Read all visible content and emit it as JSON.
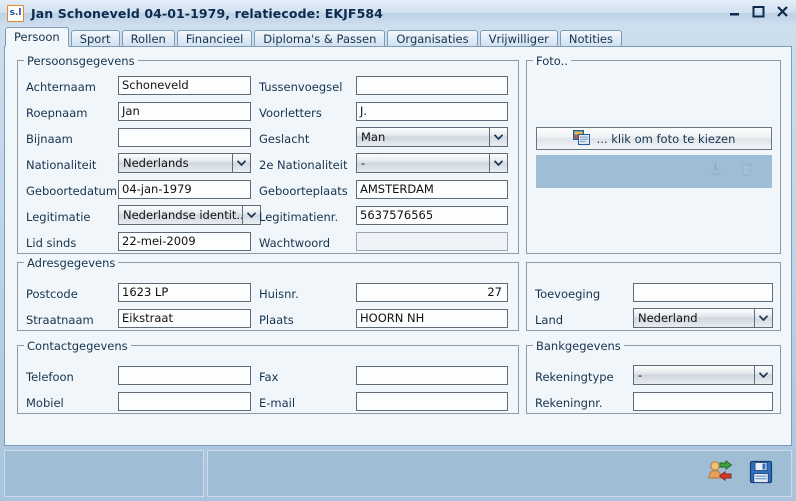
{
  "window": {
    "app_icon_text": "s.l",
    "title": "Jan Schoneveld  04-01-1979, relatiecode: EKJF584",
    "minimize_label": "Minimize",
    "maximize_label": "Maximize",
    "close_label": "Close"
  },
  "tabs": [
    {
      "label": "Persoon",
      "active": true
    },
    {
      "label": "Sport",
      "active": false
    },
    {
      "label": "Rollen",
      "active": false
    },
    {
      "label": "Financieel",
      "active": false
    },
    {
      "label": "Diploma's & Passen",
      "active": false
    },
    {
      "label": "Organisaties",
      "active": false
    },
    {
      "label": "Vrijwilliger",
      "active": false
    },
    {
      "label": "Notities",
      "active": false
    }
  ],
  "groups": {
    "persoonsgegevens": {
      "title": "Persoonsgegevens",
      "fields": {
        "achternaam": {
          "label": "Achternaam",
          "value": "Schoneveld"
        },
        "roepnaam": {
          "label": "Roepnaam",
          "value": "Jan"
        },
        "bijnaam": {
          "label": "Bijnaam",
          "value": ""
        },
        "nationaliteit": {
          "label": "Nationaliteit",
          "value": "Nederlands"
        },
        "geboortedatum": {
          "label": "Geboortedatum",
          "value": "04-jan-1979"
        },
        "legitimatie": {
          "label": "Legitimatie",
          "value": "Nederlandse identit..."
        },
        "lid_sinds": {
          "label": "Lid sinds",
          "value": "22-mei-2009"
        },
        "tussenvoegsel": {
          "label": "Tussenvoegsel",
          "value": ""
        },
        "voorletters": {
          "label": "Voorletters",
          "value": "J."
        },
        "geslacht": {
          "label": "Geslacht",
          "value": "Man"
        },
        "tweede_nationaliteit": {
          "label": "2e Nationaliteit",
          "value": "-"
        },
        "geboorteplaats": {
          "label": "Geboorteplaats",
          "value": "AMSTERDAM"
        },
        "legitimatienr": {
          "label": "Legitimatienr.",
          "value": "5637576565"
        },
        "wachtwoord": {
          "label": "Wachtwoord",
          "value": ""
        }
      }
    },
    "foto": {
      "title": "Foto..",
      "choose_button_label": "... klik om foto te kiezen",
      "choose_button_icon": "photos-icon",
      "band_icons": [
        "download-icon",
        "trash-icon"
      ]
    },
    "adresgegevens": {
      "title": "Adresgegevens",
      "fields": {
        "postcode": {
          "label": "Postcode",
          "value": "1623 LP"
        },
        "straatnaam": {
          "label": "Straatnaam",
          "value": "Eikstraat"
        },
        "huisnr": {
          "label": "Huisnr.",
          "value": "27"
        },
        "plaats": {
          "label": "Plaats",
          "value": "HOORN NH"
        },
        "toevoeging": {
          "label": "Toevoeging",
          "value": ""
        },
        "land": {
          "label": "Land",
          "value": "Nederland"
        }
      }
    },
    "contactgegevens": {
      "title": "Contactgegevens",
      "fields": {
        "telefoon": {
          "label": "Telefoon",
          "value": ""
        },
        "mobiel": {
          "label": "Mobiel",
          "value": ""
        },
        "fax": {
          "label": "Fax",
          "value": ""
        },
        "email": {
          "label": "E-mail",
          "value": ""
        }
      }
    },
    "bankgegevens": {
      "title": "Bankgegevens",
      "fields": {
        "rekeningtype": {
          "label": "Rekeningtype",
          "value": "-"
        },
        "rekeningnr": {
          "label": "Rekeningnr.",
          "value": ""
        }
      }
    }
  },
  "statusbar": {
    "panel1_text": "",
    "panel2_text": "",
    "actions": [
      {
        "name": "switch-user-icon",
        "label": ""
      },
      {
        "name": "save-icon",
        "label": ""
      }
    ]
  },
  "colors": {
    "window_bg": "#bcd2e6",
    "panel_bg": "#f1f6fa",
    "accent_band": "#9fbdd4",
    "border": "#7e9cb8",
    "group_border": "#8f9aa5",
    "field_border": "#5f6b77",
    "title_text": "#0d2b4e"
  }
}
